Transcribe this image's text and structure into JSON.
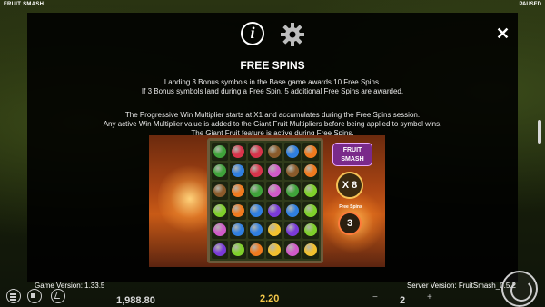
{
  "topbar": {
    "game_name": "FRUIT SMASH",
    "status": "PAUSED"
  },
  "modal": {
    "title": "FREE SPINS",
    "paragraph1": [
      "Landing 3 Bonus symbols in the Base game awards 10 Free Spins.",
      "If 3 Bonus symbols land during a Free Spin, 5 additional Free Spins are awarded."
    ],
    "paragraph2": [
      "The Progressive Win Multiplier starts at X1 and accumulates during the Free Spins session.",
      "Any active Win Multiplier value is added to the Giant Fruit Multipliers before being applied to symbol wins.",
      "The Giant Fruit feature is active during Free Spins."
    ],
    "preview": {
      "logo": "FRUIT SMASH",
      "multiplier": "X 8",
      "free_spins_label": "Free Spins",
      "free_spins_count": "3",
      "grid": [
        [
          "green",
          "red",
          "red",
          "brown",
          "blue",
          "orange"
        ],
        [
          "green",
          "blue",
          "red",
          "pink",
          "brown",
          "orange"
        ],
        [
          "brown",
          "orange",
          "green",
          "pink",
          "green",
          "lime"
        ],
        [
          "lime",
          "orange",
          "blue",
          "purple",
          "blue",
          "lime"
        ],
        [
          "pink",
          "blue",
          "blue",
          "yellow",
          "purple",
          "lime"
        ],
        [
          "purple",
          "lime",
          "orange",
          "yellow",
          "pink",
          "yellow"
        ]
      ]
    }
  },
  "footer": {
    "game_version": "Game Version: 1.33.5",
    "server_version": "Server Version: FruitSmash_0.5.2"
  },
  "bottombar": {
    "balance": "1,988.80",
    "win": "2.20",
    "bet": "2",
    "minus": "−",
    "plus": "+"
  },
  "colors": {
    "green": "#3fa33a",
    "red": "#d8344b",
    "brown": "#8a5a2a",
    "blue": "#2f7fe0",
    "orange": "#f07a1e",
    "pink": "#d05ac8",
    "lime": "#7fd02a",
    "purple": "#7a3ad8",
    "yellow": "#f2c12e"
  }
}
